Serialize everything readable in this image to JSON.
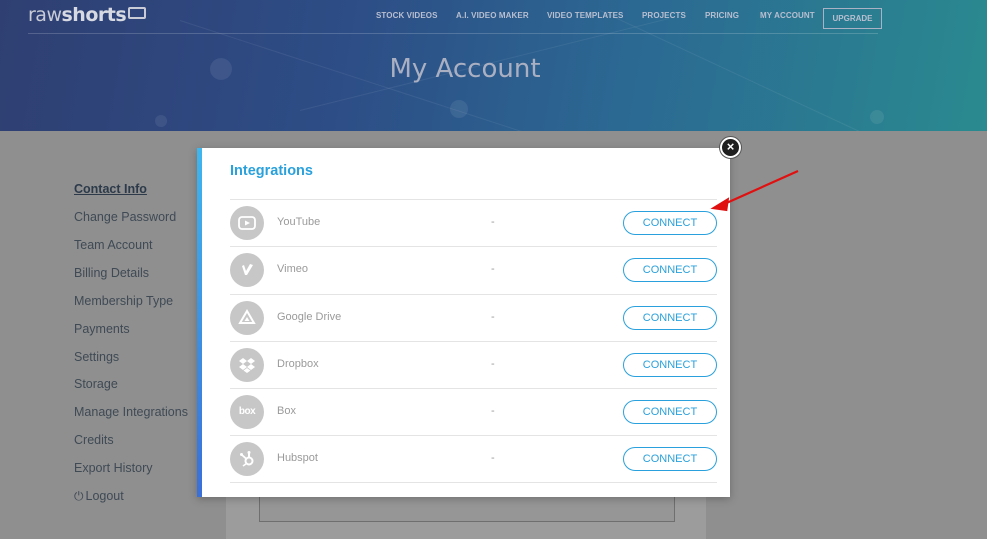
{
  "header": {
    "logo_light": "raw",
    "logo_bold": "shorts",
    "nav": [
      "STOCK VIDEOS",
      "A.I. VIDEO MAKER",
      "VIDEO TEMPLATES",
      "PROJECTS",
      "PRICING",
      "MY ACCOUNT"
    ],
    "upgrade": "UPGRADE",
    "page_title": "My Account"
  },
  "sidebar": {
    "items": [
      "Contact Info",
      "Change Password",
      "Team Account",
      "Billing Details",
      "Membership Type",
      "Payments",
      "Settings",
      "Storage",
      "Manage Integrations",
      "Credits",
      "Export History"
    ],
    "logout": "Logout"
  },
  "modal": {
    "title": "Integrations",
    "close": "×",
    "integrations": [
      {
        "name": "YouTube",
        "status": "-",
        "action": "CONNECT",
        "icon": "youtube-icon"
      },
      {
        "name": "Vimeo",
        "status": "-",
        "action": "CONNECT",
        "icon": "vimeo-icon"
      },
      {
        "name": "Google Drive",
        "status": "-",
        "action": "CONNECT",
        "icon": "google-drive-icon"
      },
      {
        "name": "Dropbox",
        "status": "-",
        "action": "CONNECT",
        "icon": "dropbox-icon"
      },
      {
        "name": "Box",
        "status": "-",
        "action": "CONNECT",
        "icon": "box-icon"
      },
      {
        "name": "Hubspot",
        "status": "-",
        "action": "CONNECT",
        "icon": "hubspot-icon"
      }
    ]
  },
  "colors": {
    "accent": "#2aa1dc",
    "annotation_arrow": "#e01010",
    "overlay": "#8f8f8f"
  }
}
